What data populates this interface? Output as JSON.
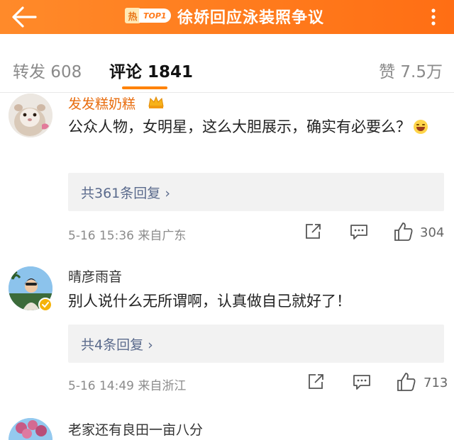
{
  "header": {
    "hot_badge_char": "热",
    "hot_badge_label": "TOP1",
    "title": "徐娇回应泳装照争议"
  },
  "tabs": {
    "reposts": "转发 608",
    "comments": "评论 1841",
    "likes": "赞 7.5万"
  },
  "comments": [
    {
      "username": "发发糕奶糕",
      "text": "公众人物，女明星，这么大胆展示，确实有必要么？",
      "replies": "共361条回复",
      "meta": "5-16 15:36 来自广东",
      "likes": "304"
    },
    {
      "username": "晴彦雨音",
      "text": "别人说什么无所谓啊，认真做自己就好了！",
      "replies": "共4条回复",
      "meta": "5-16 14:49 来自浙江",
      "likes": "713"
    },
    {
      "username": "老家还有良田一亩八分"
    }
  ],
  "icons": {
    "reply_chevron": "›"
  },
  "colors": {
    "header_orange": "#ff7a1c",
    "vip_name": "#e86d0f",
    "tab_underline": "#ff8200",
    "reply_link": "#5a6a8c"
  }
}
